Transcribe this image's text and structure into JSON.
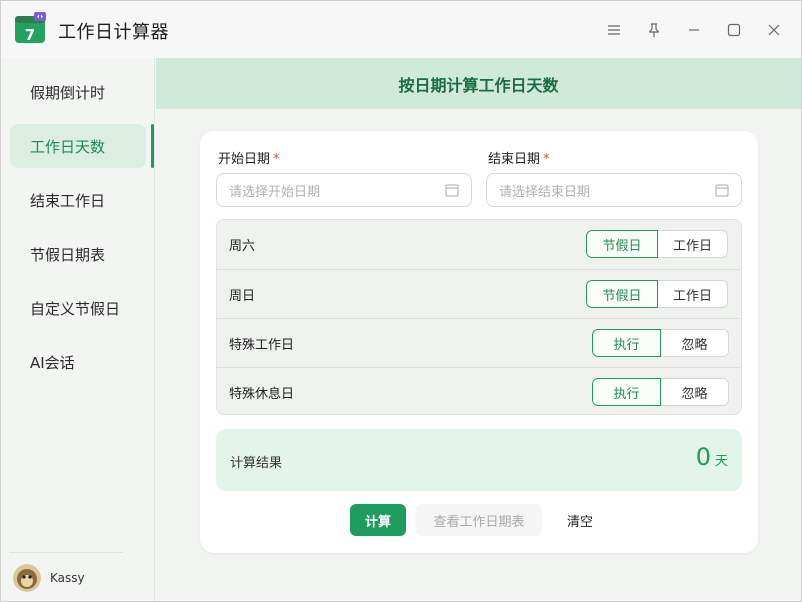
{
  "app": {
    "title": "工作日计算器",
    "icon_number": "7"
  },
  "window_controls": [
    "menu-icon",
    "pin-icon",
    "minimize-icon",
    "maximize-icon",
    "close-icon"
  ],
  "sidebar": {
    "items": [
      {
        "label": "假期倒计时"
      },
      {
        "label": "工作日天数",
        "active": true
      },
      {
        "label": "结束工作日"
      },
      {
        "label": "节假日期表"
      },
      {
        "label": "自定义节假日"
      },
      {
        "label": "AI会话"
      }
    ],
    "user": {
      "name": "Kassy"
    }
  },
  "main": {
    "header": "按日期计算工作日天数",
    "start_date": {
      "label": "开始日期",
      "required_mark": "*",
      "placeholder": "请选择开始日期",
      "value": ""
    },
    "end_date": {
      "label": "结束日期",
      "required_mark": "*",
      "placeholder": "请选择结束日期",
      "value": ""
    },
    "options": [
      {
        "label": "周六",
        "choices": [
          "节假日",
          "工作日"
        ],
        "selected": "节假日"
      },
      {
        "label": "周日",
        "choices": [
          "节假日",
          "工作日"
        ],
        "selected": "节假日"
      },
      {
        "label": "特殊工作日",
        "choices": [
          "执行",
          "忽略"
        ],
        "selected": "执行"
      },
      {
        "label": "特殊休息日",
        "choices": [
          "执行",
          "忽略"
        ],
        "selected": "执行"
      }
    ],
    "result": {
      "label": "计算结果",
      "value": "0",
      "unit": "天"
    },
    "buttons": {
      "calculate": "计算",
      "view_table": "查看工作日期表",
      "clear": "清空"
    }
  },
  "colors": {
    "accent": "#1e9c5c",
    "header_bg": "#cfe9da",
    "result_bg": "#e3f4ea",
    "required": "#e34b4b"
  }
}
